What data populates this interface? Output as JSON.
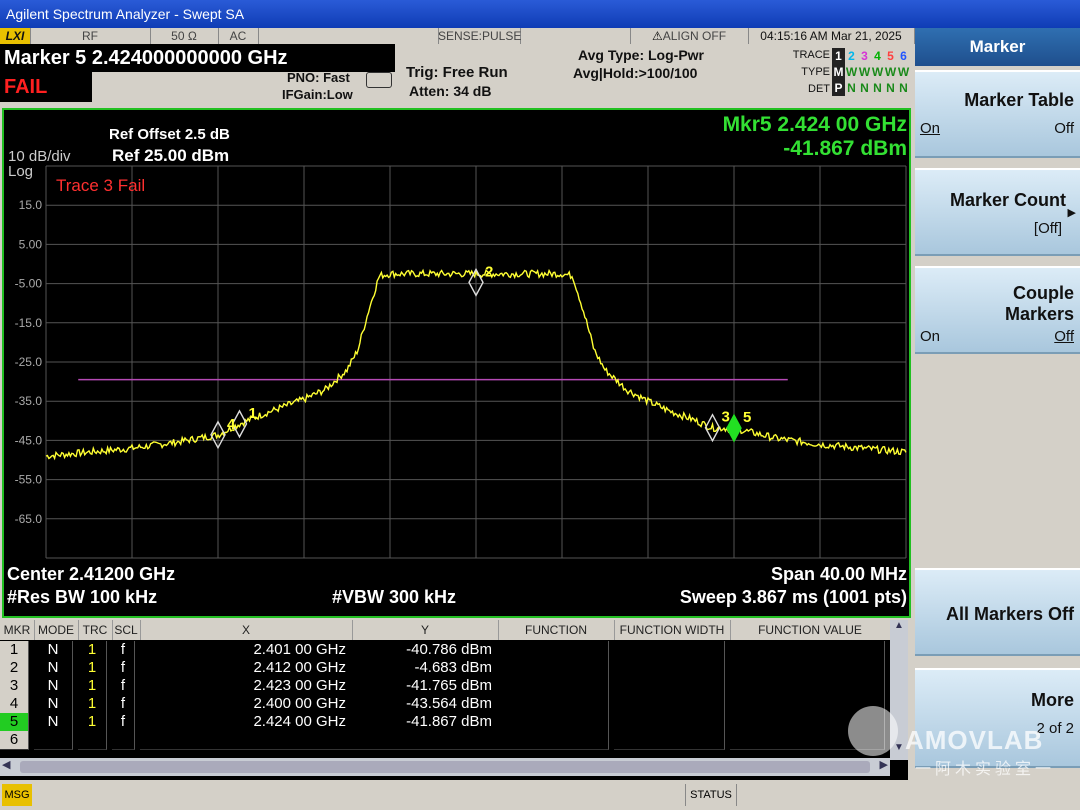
{
  "window": {
    "title": "Agilent Spectrum Analyzer - Swept SA"
  },
  "status_row": {
    "logo": "LXI",
    "rf": "RF",
    "impedance": "50 Ω",
    "coupling": "AC",
    "sense": "SENSE:PULSE",
    "align": "ALIGN OFF",
    "datetime": "04:15:16 AM Mar 21, 2025"
  },
  "marker_header": "Marker 5 2.424000000000 GHz",
  "fail_label": "FAIL",
  "settings": {
    "pno": "PNO: Fast",
    "ifgain": "IFGain:Low",
    "trig": "Trig: Free Run",
    "atten": "Atten: 34 dB",
    "avg_type": "Avg Type: Log-Pwr",
    "avg_hold": "Avg|Hold:>100/100"
  },
  "trace_legend": {
    "trace_label": "TRACE",
    "type_label": "TYPE",
    "det_label": "DET",
    "numbers": [
      "1",
      "2",
      "3",
      "4",
      "5",
      "6"
    ],
    "number_colors": [
      "#ffffff",
      "#00b7eb",
      "#d633d6",
      "#00b000",
      "#ff4040",
      "#2255ff"
    ],
    "type_row": [
      "M",
      "W",
      "W",
      "W",
      "W",
      "W"
    ],
    "det_row": [
      "P",
      "N",
      "N",
      "N",
      "N",
      "N"
    ]
  },
  "screen": {
    "scale": "10 dB/div",
    "log": "Log",
    "ref_offset": "Ref Offset 2.5 dB",
    "ref_level": "Ref 25.00 dBm",
    "mkr_readout_freq": "Mkr5 2.424 00 GHz",
    "mkr_readout_amp": "-41.867 dBm",
    "fail_msg": "Trace 3 Fail",
    "y_ticks": [
      "15.0",
      "5.00",
      "-5.00",
      "-15.0",
      "-25.0",
      "-35.0",
      "-45.0",
      "-55.0",
      "-65.0"
    ],
    "center": "Center 2.41200 GHz",
    "span": "Span 40.00 MHz",
    "rbw": "#Res BW 100 kHz",
    "vbw": "#VBW 300 kHz",
    "sweep": "Sweep  3.867 ms (1001 pts)",
    "marker_labels": [
      "1",
      "2",
      "3",
      "4",
      "5"
    ]
  },
  "chart_data": {
    "type": "line",
    "xlim": [
      2392.0,
      2432.0
    ],
    "ylim": [
      -75,
      25
    ],
    "x_unit": "MHz",
    "y_unit": "dBm",
    "series": [
      {
        "values_x": [
          2392.0,
          2394.0,
          2396.0,
          2398.0,
          2400.0,
          2401.0,
          2402.0,
          2403.0,
          2404.0,
          2405.0,
          2406.0,
          2406.5,
          2407.0,
          2407.5,
          2408.0,
          2416.0,
          2416.5,
          2417.0,
          2417.5,
          2418.0,
          2419.0,
          2420.0,
          2421.0,
          2422.0,
          2423.0,
          2424.0,
          2426.0,
          2428.0,
          2430.0,
          2432.0
        ],
        "values_y": [
          -49,
          -48,
          -47,
          -45.5,
          -43.6,
          -40.8,
          -38.5,
          -36.5,
          -34.5,
          -32,
          -27,
          -22,
          -12,
          -3,
          -2.5,
          -2.5,
          -3,
          -12,
          -22,
          -27,
          -32,
          -35,
          -37.5,
          -39.5,
          -41.8,
          -41.9,
          -44.5,
          -46,
          -47,
          -48
        ]
      }
    ],
    "limit_line": {
      "x": [
        2393.5,
        2426.5
      ],
      "y": [
        -29.5,
        -29.5
      ]
    },
    "markers": [
      {
        "id": "1",
        "x": 2401.0,
        "y": -40.786
      },
      {
        "id": "2",
        "x": 2412.0,
        "y": -4.683
      },
      {
        "id": "3",
        "x": 2423.0,
        "y": -41.765
      },
      {
        "id": "4",
        "x": 2400.0,
        "y": -43.564
      },
      {
        "id": "5",
        "x": 2424.0,
        "y": -41.867
      }
    ]
  },
  "table": {
    "headers": [
      "MKR",
      "MODE",
      "TRC",
      "SCL",
      "X",
      "Y",
      "FUNCTION",
      "FUNCTION WIDTH",
      "FUNCTION VALUE"
    ],
    "rows": [
      [
        "1",
        "N",
        "1",
        "f",
        "2.401 00 GHz",
        "-40.786 dBm"
      ],
      [
        "2",
        "N",
        "1",
        "f",
        "2.412 00 GHz",
        "-4.683 dBm"
      ],
      [
        "3",
        "N",
        "1",
        "f",
        "2.423 00 GHz",
        "-41.765 dBm"
      ],
      [
        "4",
        "N",
        "1",
        "f",
        "2.400 00 GHz",
        "-43.564 dBm"
      ],
      [
        "5",
        "N",
        "1",
        "f",
        "2.424 00 GHz",
        "-41.867 dBm"
      ],
      [
        "6",
        "",
        "",
        "",
        "",
        ""
      ]
    ]
  },
  "softkeys": {
    "header": "Marker",
    "marker_table": "Marker Table",
    "marker_table_on": "On",
    "marker_table_off": "Off",
    "marker_count": "Marker Count",
    "marker_count_value": "[Off]",
    "couple": "Couple",
    "couple2": "Markers",
    "couple_on": "On",
    "couple_off": "Off",
    "all_off": "All Markers Off",
    "more": "More",
    "more_page": "2 of 2"
  },
  "watermark": {
    "brand": "AMOVLAB",
    "cn": "一阿木实验室一"
  },
  "bottom": {
    "msg": "MSG",
    "status": "STATUS"
  }
}
